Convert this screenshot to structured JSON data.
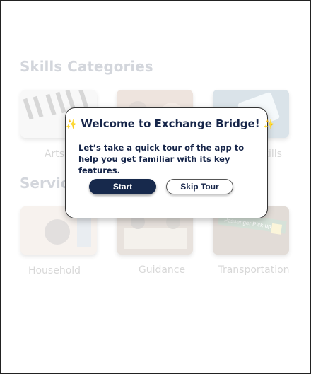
{
  "sections": {
    "skills_title": "Skills Categories",
    "services_title": "Services"
  },
  "skills_cards": [
    {
      "label": "Arts",
      "icon": "piano-keys-image"
    },
    {
      "label": "",
      "icon": "people-image"
    },
    {
      "label": "Skills",
      "icon": "tablet-image"
    }
  ],
  "services_cards": [
    {
      "label": "Household",
      "icon": "household-image"
    },
    {
      "label": "Guidance",
      "icon": "guidance-image"
    },
    {
      "label": "Transportation",
      "icon": "transport-sign-image"
    }
  ],
  "sign_text": "Passenger Pick-up",
  "modal": {
    "title": "Welcome to Exchange Bridge!",
    "sparkle": "✨",
    "body": "Let’s take a quick tour of the app to help you get familiar with its key features.",
    "start_label": "Start",
    "skip_label": "Skip Tour"
  },
  "colors": {
    "primary": "#17294c",
    "accent": "#f2b51d"
  }
}
